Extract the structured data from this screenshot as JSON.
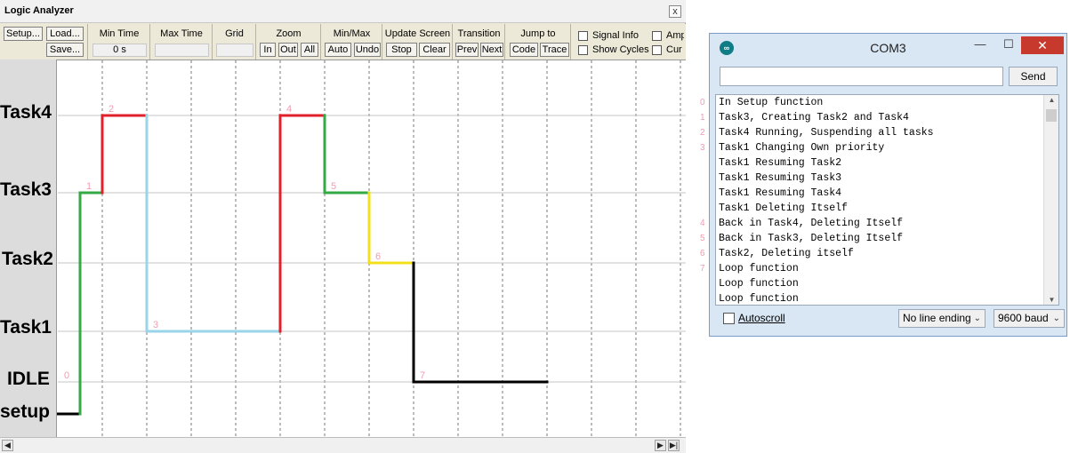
{
  "logic_analyzer": {
    "title": "Logic Analyzer",
    "close_glyph": "x",
    "toolbar": {
      "setup_label": "Setup...",
      "load_label": "Load...",
      "save_label": "Save...",
      "min_time_label": "Min Time",
      "min_time_value": "0 s",
      "max_time_label": "Max Time",
      "grid_label": "Grid",
      "zoom_label": "Zoom",
      "zoom_in": "In",
      "zoom_out": "Out",
      "zoom_all": "All",
      "minmax_label": "Min/Max",
      "auto_label": "Auto",
      "undo_label": "Undo",
      "update_label": "Update Screen",
      "stop_label": "Stop",
      "clear_label": "Clear",
      "transition_label": "Transition",
      "prev_label": "Prev",
      "next_label": "Next",
      "jump_label": "Jump to",
      "code_label": "Code",
      "trace_label": "Trace",
      "signal_info_label": "Signal Info",
      "show_cycles_label": "Show Cycles",
      "amp_label": "Amp",
      "cur_label": "Cur"
    },
    "task_labels": [
      "Task4",
      "Task3",
      "Task2",
      "Task1",
      "IDLE",
      "setup"
    ],
    "trace_segments": [
      {
        "from": [
          0,
          "setup"
        ],
        "to": [
          0.5,
          "setup"
        ],
        "color": "#000000"
      },
      {
        "from": [
          0.5,
          "setup"
        ],
        "to": [
          0.5,
          "Task3"
        ],
        "color": "#33aa44"
      },
      {
        "from": [
          0.5,
          "Task3"
        ],
        "to": [
          1,
          "Task3"
        ],
        "color": "#33aa44"
      },
      {
        "from": [
          1,
          "Task3"
        ],
        "to": [
          1,
          "Task4"
        ],
        "color": "#e0202a"
      },
      {
        "from": [
          1,
          "Task4"
        ],
        "to": [
          2,
          "Task4"
        ],
        "color": "#e0202a"
      },
      {
        "from": [
          2,
          "Task4"
        ],
        "to": [
          2,
          "Task1"
        ],
        "color": "#99d4e8"
      },
      {
        "from": [
          2,
          "Task1"
        ],
        "to": [
          5,
          "Task1"
        ],
        "color": "#99d4e8"
      },
      {
        "from": [
          5,
          "Task1"
        ],
        "to": [
          5,
          "Task4"
        ],
        "color": "#e0202a"
      },
      {
        "from": [
          5,
          "Task4"
        ],
        "to": [
          6,
          "Task4"
        ],
        "color": "#e0202a"
      },
      {
        "from": [
          6,
          "Task4"
        ],
        "to": [
          6,
          "Task3"
        ],
        "color": "#33aa44"
      },
      {
        "from": [
          6,
          "Task3"
        ],
        "to": [
          7,
          "Task3"
        ],
        "color": "#33aa44"
      },
      {
        "from": [
          7,
          "Task3"
        ],
        "to": [
          7,
          "Task2"
        ],
        "color": "#f2e01a"
      },
      {
        "from": [
          7,
          "Task2"
        ],
        "to": [
          8,
          "Task2"
        ],
        "color": "#f2e01a"
      },
      {
        "from": [
          8,
          "Task2"
        ],
        "to": [
          8,
          "IDLE"
        ],
        "color": "#000000"
      },
      {
        "from": [
          8,
          "IDLE"
        ],
        "to": [
          11,
          "IDLE"
        ],
        "color": "#000000"
      }
    ],
    "markers": [
      {
        "text": "0",
        "level": "IDLE",
        "grid": 0
      },
      {
        "text": "1",
        "level": "Task3",
        "grid": 0.5
      },
      {
        "text": "2",
        "level": "Task4",
        "grid": 1
      },
      {
        "text": "3",
        "level": "Task1",
        "grid": 2
      },
      {
        "text": "4",
        "level": "Task4",
        "grid": 5
      },
      {
        "text": "5",
        "level": "Task3",
        "grid": 6
      },
      {
        "text": "6",
        "level": "Task2",
        "grid": 7
      },
      {
        "text": "7",
        "level": "IDLE",
        "grid": 8
      }
    ],
    "marker_color": "#f19cb0"
  },
  "serial_monitor": {
    "title": "COM3",
    "icon": "arduino-icon",
    "minimize_glyph": "—",
    "maximize_glyph": "☐",
    "close_glyph": "✕",
    "input_value": "",
    "send_label": "Send",
    "output_lines": [
      "In Setup function",
      "Task3, Creating Task2 and Task4",
      "Task4 Running, Suspending all tasks",
      "Task1 Changing Own priority",
      "Task1 Resuming Task2",
      "Task1 Resuming Task3",
      "Task1 Resuming Task4",
      "Task1 Deleting Itself",
      "Back in Task4, Deleting Itself",
      "Back in Task3, Deleting Itself",
      "Task2, Deleting itself",
      "Loop function",
      "Loop function",
      "Loop function"
    ],
    "line_numbers": [
      {
        "text": "0",
        "line": 0
      },
      {
        "text": "1",
        "line": 1
      },
      {
        "text": "2",
        "line": 2
      },
      {
        "text": "3",
        "line": 3
      },
      {
        "text": "4",
        "line": 8
      },
      {
        "text": "5",
        "line": 9
      },
      {
        "text": "6",
        "line": 10
      },
      {
        "text": "7",
        "line": 11
      }
    ],
    "autoscroll_label": "Autoscroll",
    "autoscroll_checked": false,
    "line_ending": "No line ending",
    "baud": "9600 baud"
  }
}
